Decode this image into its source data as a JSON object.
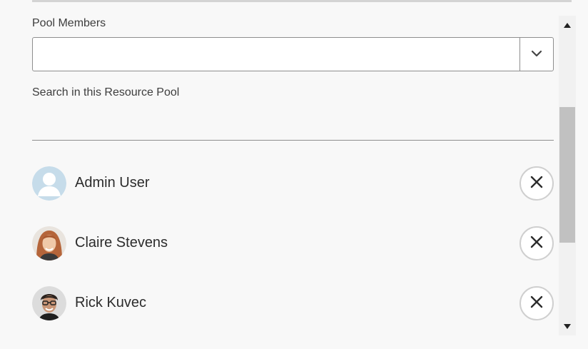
{
  "pool_members": {
    "label": "Pool Members",
    "input_value": "",
    "dropdown_icon": "chevron-down-icon"
  },
  "search": {
    "label": "Search in this Resource Pool"
  },
  "members": [
    {
      "name": "Admin User",
      "avatar": "default-user-avatar",
      "remove_icon": "close-icon"
    },
    {
      "name": "Claire Stevens",
      "avatar": "photo-avatar",
      "remove_icon": "close-icon"
    },
    {
      "name": "Rick Kuvec",
      "avatar": "photo-avatar",
      "remove_icon": "close-icon"
    }
  ],
  "colors": {
    "background": "#f8f8f8",
    "border": "#8e8e8e",
    "remove_button_border": "#cfcfcf",
    "scroll_thumb": "#c1c1c1"
  }
}
